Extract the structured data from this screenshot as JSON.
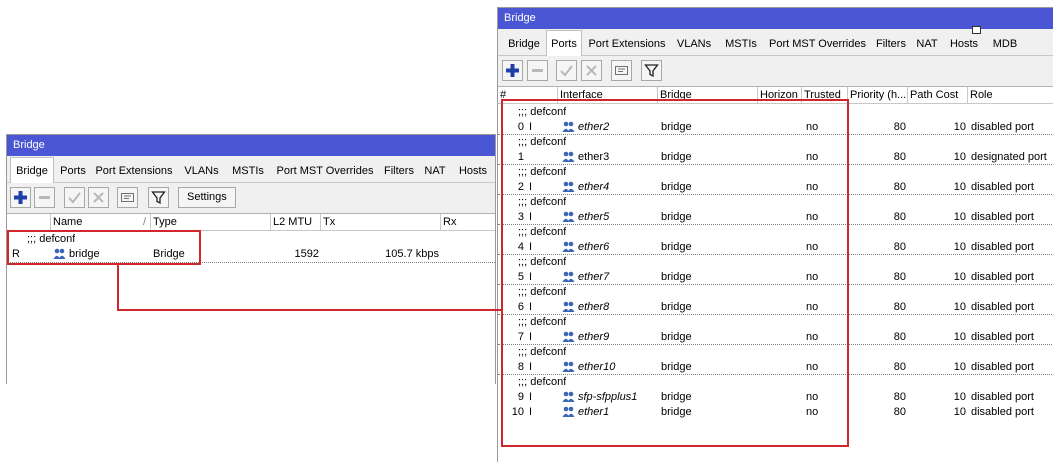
{
  "left_window": {
    "title": "Bridge",
    "tabs": [
      "Bridge",
      "Ports",
      "Port Extensions",
      "VLANs",
      "MSTIs",
      "Port MST Overrides",
      "Filters",
      "NAT",
      "Hosts"
    ],
    "active_tab": "Bridge",
    "toolbar": {
      "settings_label": "Settings"
    },
    "columns": [
      "Name",
      "Type",
      "L2 MTU",
      "Tx",
      "Rx"
    ],
    "comment": ";;; defconf",
    "row": {
      "flag": "R",
      "name": "bridge",
      "type": "Bridge",
      "l2mtu": "1592",
      "tx": "105.7 kbps",
      "rx": ""
    }
  },
  "right_window": {
    "title": "Bridge",
    "tabs": [
      "Bridge",
      "Ports",
      "Port Extensions",
      "VLANs",
      "MSTIs",
      "Port MST Overrides",
      "Filters",
      "NAT",
      "Hosts",
      "MDB"
    ],
    "active_tab": "Ports",
    "columns": [
      "#",
      "Interface",
      "Bridge",
      "Horizon",
      "Trusted",
      "Priority (h...",
      "Path Cost",
      "Role"
    ],
    "rows": [
      {
        "comment": ";;; defconf",
        "num": "0",
        "flag": "I",
        "iface": "ether2",
        "bridge": "bridge",
        "horizon": "",
        "trusted": "no",
        "priority": "80",
        "cost": "10",
        "role": "disabled port"
      },
      {
        "comment": ";;; defconf",
        "num": "1",
        "flag": "",
        "iface": "ether3",
        "bridge": "bridge",
        "horizon": "",
        "trusted": "no",
        "priority": "80",
        "cost": "10",
        "role": "designated port"
      },
      {
        "comment": ";;; defconf",
        "num": "2",
        "flag": "I",
        "iface": "ether4",
        "bridge": "bridge",
        "horizon": "",
        "trusted": "no",
        "priority": "80",
        "cost": "10",
        "role": "disabled port"
      },
      {
        "comment": ";;; defconf",
        "num": "3",
        "flag": "I",
        "iface": "ether5",
        "bridge": "bridge",
        "horizon": "",
        "trusted": "no",
        "priority": "80",
        "cost": "10",
        "role": "disabled port"
      },
      {
        "comment": ";;; defconf",
        "num": "4",
        "flag": "I",
        "iface": "ether6",
        "bridge": "bridge",
        "horizon": "",
        "trusted": "no",
        "priority": "80",
        "cost": "10",
        "role": "disabled port"
      },
      {
        "comment": ";;; defconf",
        "num": "5",
        "flag": "I",
        "iface": "ether7",
        "bridge": "bridge",
        "horizon": "",
        "trusted": "no",
        "priority": "80",
        "cost": "10",
        "role": "disabled port"
      },
      {
        "comment": ";;; defconf",
        "num": "6",
        "flag": "I",
        "iface": "ether8",
        "bridge": "bridge",
        "horizon": "",
        "trusted": "no",
        "priority": "80",
        "cost": "10",
        "role": "disabled port"
      },
      {
        "comment": ";;; defconf",
        "num": "7",
        "flag": "I",
        "iface": "ether9",
        "bridge": "bridge",
        "horizon": "",
        "trusted": "no",
        "priority": "80",
        "cost": "10",
        "role": "disabled port"
      },
      {
        "comment": ";;; defconf",
        "num": "8",
        "flag": "I",
        "iface": "ether10",
        "bridge": "bridge",
        "horizon": "",
        "trusted": "no",
        "priority": "80",
        "cost": "10",
        "role": "disabled port"
      },
      {
        "comment": ";;; defconf",
        "num": "9",
        "flag": "I",
        "iface": "sfp-sfpplus1",
        "bridge": "bridge",
        "horizon": "",
        "trusted": "no",
        "priority": "80",
        "cost": "10",
        "role": "disabled port"
      },
      {
        "comment": "",
        "num": "10",
        "flag": "I",
        "iface": "ether1",
        "bridge": "bridge",
        "horizon": "",
        "trusted": "no",
        "priority": "80",
        "cost": "10",
        "role": "disabled port"
      }
    ]
  },
  "colors": {
    "titlebar": "#4a56d4",
    "highlight": "#d0262c",
    "add_icon": "#1f3fa8",
    "iface_icon": "#3a66b8"
  }
}
